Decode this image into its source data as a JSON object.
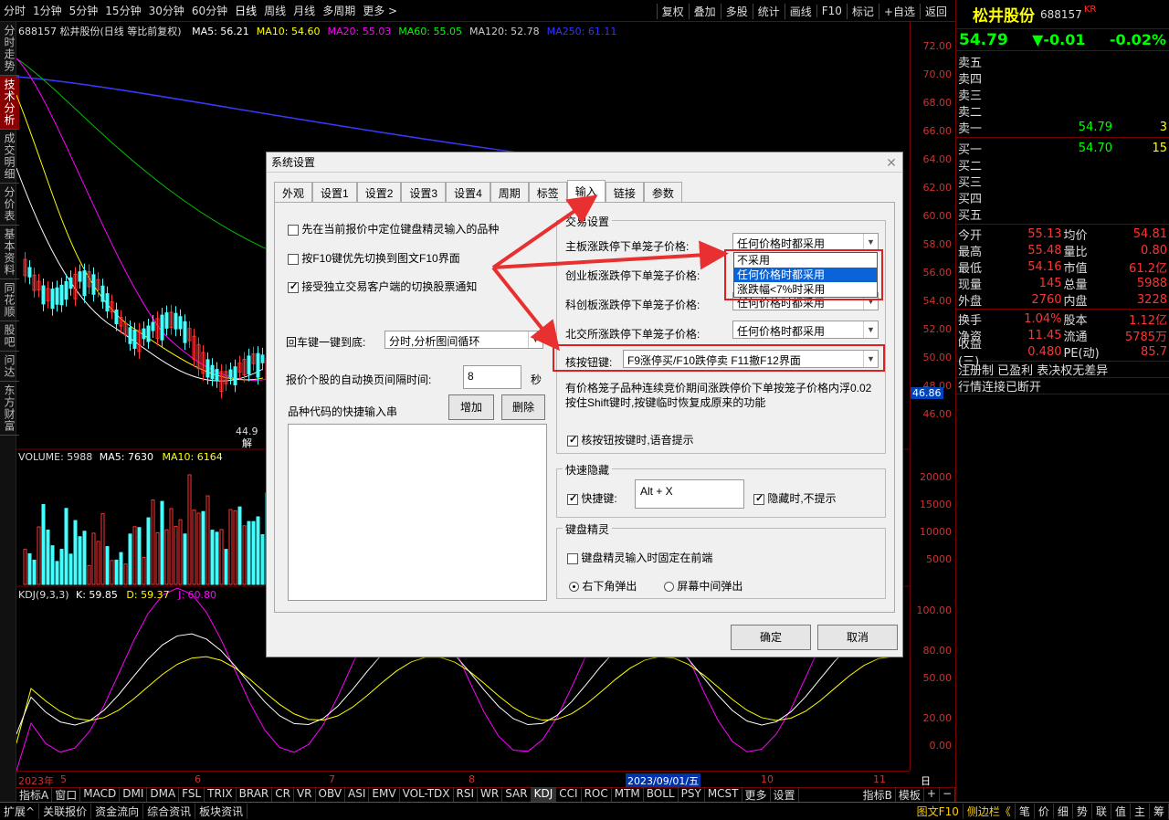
{
  "topbar": {
    "periods": [
      "分时",
      "1分钟",
      "5分钟",
      "15分钟",
      "30分钟",
      "60分钟",
      "日线",
      "周线",
      "月线",
      "多周期",
      "更多 >"
    ],
    "tools": [
      "复权",
      "叠加",
      "多股",
      "统计",
      "画线",
      "F10",
      "标记",
      "+自选",
      "返回"
    ]
  },
  "leftnav": [
    "分时走势",
    "技术分析",
    "成交明细",
    "分价表",
    "基本资料",
    "同花顺",
    "股吧",
    "问达",
    "东方财富"
  ],
  "chart": {
    "header": "688157 松井股份(日线 等比前复权)",
    "ma": [
      {
        "label": "MA5: 56.21",
        "color": "#ffffff"
      },
      {
        "label": "MA10: 54.60",
        "color": "#ffff00"
      },
      {
        "label": "MA20: 55.03",
        "color": "#ff00ff"
      },
      {
        "label": "MA60: 55.05",
        "color": "#00ff00"
      },
      {
        "label": "MA120: 52.78",
        "color": "#cccccc"
      },
      {
        "label": "MA250: 61.11",
        "color": "#3333ff"
      }
    ],
    "volume_header": "VOLUME: 5988",
    "vol_ma5": "MA5: 7630",
    "vol_ma10": "MA10: 6164",
    "kdj_header": "KDJ(9,3,3)",
    "kdj_k": "K: 59.85",
    "kdj_d": "D: 59.37",
    "kdj_j": "J: 60.80",
    "price_ticks": [
      "72.00",
      "70.00",
      "68.00",
      "66.00",
      "64.00",
      "62.00",
      "60.00",
      "58.00",
      "56.00",
      "54.00",
      "52.00",
      "50.00",
      "48.00",
      "46.00"
    ],
    "current_price_tag": "46.86",
    "low_label": "44.9",
    "jie_label": "解",
    "vol_ticks": [
      "20000",
      "15000",
      "10000",
      "5000"
    ],
    "kdj_ticks": [
      "100.00",
      "80.00",
      "50.00",
      "20.00",
      "0.00"
    ],
    "date_labels": [
      "2023年",
      "5",
      "6",
      "7",
      "8",
      "2023/09/01/五",
      "10",
      "11"
    ],
    "axis_btn": "日线"
  },
  "chart_data": {
    "type": "line",
    "title": "688157 松井股份(日线 等比前复权)",
    "ylim": [
      46,
      72
    ]
  },
  "bottombar": [
    "指标A",
    "窗口",
    "MACD",
    "DMI",
    "DMA",
    "FSL",
    "TRIX",
    "BRAR",
    "CR",
    "VR",
    "OBV",
    "ASI",
    "EMV",
    "VOL-TDX",
    "RSI",
    "WR",
    "SAR",
    "KDJ",
    "CCI",
    "ROC",
    "MTM",
    "BOLL",
    "PSY",
    "MCST",
    "更多",
    "设置"
  ],
  "bottombar_right": [
    "指标B",
    "模板",
    "+",
    "−"
  ],
  "statusbar": [
    "扩展^",
    "关联报价",
    "资金流向",
    "综合资讯",
    "板块资讯"
  ],
  "statusbar_right": [
    "图文F10",
    "侧边栏《",
    "笔",
    "价",
    "细",
    "势",
    "联",
    "值",
    "主",
    "筹"
  ],
  "stock": {
    "name": "松井股份",
    "code": "688157",
    "tag": "KR",
    "price": "54.79",
    "change": "▼-0.01",
    "pct": "-0.02%",
    "sell": [
      {
        "l": "卖五",
        "p": "",
        "v": ""
      },
      {
        "l": "卖四",
        "p": "",
        "v": ""
      },
      {
        "l": "卖三",
        "p": "",
        "v": ""
      },
      {
        "l": "卖二",
        "p": "",
        "v": ""
      },
      {
        "l": "卖一",
        "p": "54.79",
        "v": "3"
      }
    ],
    "buy": [
      {
        "l": "买一",
        "p": "54.70",
        "v": "15"
      },
      {
        "l": "买二",
        "p": "",
        "v": ""
      },
      {
        "l": "买三",
        "p": "",
        "v": ""
      },
      {
        "l": "买四",
        "p": "",
        "v": ""
      },
      {
        "l": "买五",
        "p": "",
        "v": ""
      }
    ],
    "stats": [
      [
        "今开",
        "55.13",
        "均价",
        "54.81"
      ],
      [
        "最高",
        "55.48",
        "量比",
        "0.80"
      ],
      [
        "最低",
        "54.16",
        "市值",
        "61.2亿"
      ],
      [
        "现量",
        "145",
        "总量",
        "5988"
      ],
      [
        "外盘",
        "2760",
        "内盘",
        "3228"
      ]
    ],
    "stats2": [
      [
        "换手",
        "1.04%",
        "股本",
        "1.12亿"
      ],
      [
        "净资",
        "11.45",
        "流通",
        "5785万"
      ],
      [
        "收益(三)",
        "0.480",
        "PE(动)",
        "85.7"
      ]
    ],
    "notes": [
      "注册制 已盈利 表决权无差异",
      "行情连接已断开"
    ]
  },
  "dialog": {
    "title": "系统设置",
    "tabs": [
      "外观",
      "设置1",
      "设置2",
      "设置3",
      "设置4",
      "周期",
      "标签",
      "输入",
      "链接",
      "参数"
    ],
    "left": {
      "opt1": "先在当前报价中定位键盘精灵输入的品种",
      "opt2": "按F10键优先切换到图文F10界面",
      "opt3": "接受独立交易客户端的切换股票通知",
      "enter_label": "回车键一键到底:",
      "enter_value": "分时,分析图间循环",
      "interval_label": "报价个股的自动换页间隔时间:",
      "interval_value": "8",
      "interval_unit": "秒",
      "quick_label": "品种代码的快捷输入串",
      "add_btn": "增加",
      "del_btn": "删除"
    },
    "trade": {
      "group": "交易设置",
      "main_label": "主板涨跌停下单笼子价格:",
      "main_value": "任何价格时都采用",
      "cyb_label": "创业板涨跌停下单笼子价格:",
      "kcb_label": "科创板涨跌停下单笼子价格:",
      "kcb_value": "任何价格时都采用",
      "bj_label": "北交所涨跌停下单笼子价格:",
      "bj_value": "任何价格时都采用",
      "dropdown": [
        "不采用",
        "任何价格时都采用",
        "涨跌幅<7%时采用"
      ],
      "hotkey_label": "核按钮键:",
      "hotkey_value": "F9涨停买/F10跌停卖 F11撤F12界面",
      "desc": "有价格笼子品种连续竞价期间涨跌停价下单按笼子价格内浮0.02按住Shift键时,按键临时恢复成原来的功能",
      "voice": "核按钮按键时,语音提示"
    },
    "hide": {
      "group": "快速隐藏",
      "hotkey_cb": "快捷键:",
      "hotkey_value": "Alt + X",
      "no_prompt": "隐藏时,不提示"
    },
    "wizard": {
      "group": "键盘精灵",
      "fixed": "键盘精灵输入时固定在前端",
      "r1": "右下角弹出",
      "r2": "屏幕中间弹出"
    },
    "ok": "确定",
    "cancel": "取消"
  }
}
